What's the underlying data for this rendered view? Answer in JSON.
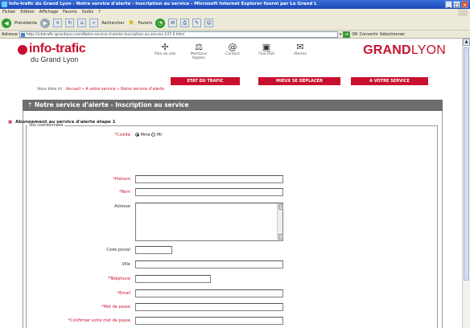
{
  "window": {
    "title": "Info-trafic du Grand Lyon - Notre service d'alerte - Inscription au service - Microsoft Internet Explorer fourni par Le Grand L"
  },
  "menubar": [
    "Fichier",
    "Edition",
    "Affichage",
    "Favoris",
    "Outils",
    "?"
  ],
  "toolbar": {
    "back_label": "Précédente",
    "search_label": "Rechercher",
    "favorites_label": "Favoris"
  },
  "addressbar": {
    "label": "Adresse",
    "url": "http://infotrafic.grandlyon.com/Notre-service-d-alerte-Inscription-au-service.147.0.html",
    "ok_label": "OK",
    "converter_label": "Convertir",
    "select_label": "Sélectionner"
  },
  "site": {
    "logo_line1": "info-trafic",
    "logo_line2": "du Grand Lyon",
    "brand_part1": "GRAND",
    "brand_part2": "LYON",
    "nav": [
      {
        "label": "Plan du site",
        "icon": "sitemap-icon",
        "glyph": "✢"
      },
      {
        "label": "Mentions légales",
        "icon": "legal-icon",
        "glyph": "⚖"
      },
      {
        "label": "Contact",
        "icon": "contact-icon",
        "glyph": "@"
      },
      {
        "label": "Flux RSS",
        "icon": "rss-icon",
        "glyph": "▣"
      },
      {
        "label": "Alertes",
        "icon": "alert-icon",
        "glyph": "✉"
      }
    ],
    "tabs": [
      "ETAT DU TRAFIC",
      "MIEUX SE DÉPLACER",
      "A VOTRE SERVICE"
    ]
  },
  "breadcrumb": {
    "prefix": "Vous êtes ici :",
    "items": [
      "Accueil",
      "A votre service",
      "Notre service d'alerte"
    ],
    "separator": "»"
  },
  "panel": {
    "title": "Notre service d'alerte - Inscription au service",
    "step_title": "Abonnement au service d'alerte étape 1",
    "legend": "Vos coordonnées"
  },
  "form": {
    "civilite_label": "*Civilité",
    "civilite_options": [
      "Mme",
      "Mr"
    ],
    "fields": [
      {
        "label": "*Prénom",
        "required": true
      },
      {
        "label": "*Nom",
        "required": true
      },
      {
        "label": "Adresse",
        "required": false
      },
      {
        "label": "Code postal",
        "required": false
      },
      {
        "label": "Ville",
        "required": false
      },
      {
        "label": "*Téléphone",
        "required": true
      },
      {
        "label": "*Email",
        "required": true
      },
      {
        "label": "*Mot de passe",
        "required": true
      },
      {
        "label": "*Confirmer votre mot de passe",
        "required": true
      }
    ]
  },
  "colors": {
    "accent": "#c8102e",
    "panel_header": "#6d6d6d"
  }
}
